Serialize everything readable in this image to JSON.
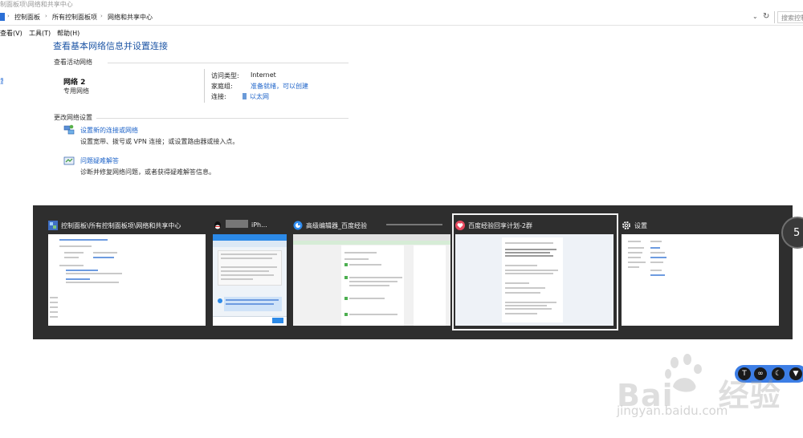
{
  "window": {
    "title": "制面板项\\网络和共享中心"
  },
  "address": {
    "crumbs": [
      "控制面板",
      "所有控制面板项",
      "网络和共享中心"
    ],
    "search_placeholder": "搜索控制面板"
  },
  "menu": {
    "items": [
      "查看(V)",
      "工具(T)",
      "帮助(H)"
    ]
  },
  "left_pane": {
    "fragment": "置"
  },
  "main": {
    "title": "查看基本网络信息并设置连接",
    "active_networks_heading": "查看活动网络",
    "network": {
      "name": "网络 2",
      "type": "专用网络"
    },
    "access_type_label": "访问类型:",
    "access_type_value": "Internet",
    "homegroup_label": "家庭组:",
    "homegroup_value": "准备就绪，可以创建",
    "connections_label": "连接:",
    "connections_value": "以太网",
    "change_settings_heading": "更改网络设置",
    "tasks": [
      {
        "link": "设置新的连接或网络",
        "desc": "设置宽带、拨号或 VPN 连接；或设置路由器或接入点。"
      },
      {
        "link": "问题疑难解答",
        "desc": "诊断并修复网络问题，或者获得疑难解答信息。"
      }
    ]
  },
  "switcher": {
    "windows": [
      {
        "title": "控制面板\\所有控制面板项\\网络和共享中心",
        "icon": "control-panel-icon"
      },
      {
        "title": "iPh...",
        "icon": "qq-icon"
      },
      {
        "title": "高级编辑器_百度经验",
        "icon": "browser-icon"
      },
      {
        "title": "百度经验回享计划-2群",
        "icon": "group-chat-icon",
        "selected": true
      },
      {
        "title": "设置",
        "icon": "gear-icon"
      }
    ],
    "thumb2": {
      "lines": [
        "我们的经验，我们看看",
        "复习内容的分享"
      ],
      "link_text": "https://...baidu.com/...",
      "send": "发送"
    }
  },
  "timer": {
    "value": "5"
  },
  "watermark": {
    "brand": "Bai",
    "brand_cn": "经验",
    "url": "jingyan.baidu.com"
  },
  "colors": {
    "link": "#1d63c9",
    "title": "#1d55a5",
    "switcher_bg": "#2e2e2e",
    "toolbar": "#3d7ee5"
  }
}
